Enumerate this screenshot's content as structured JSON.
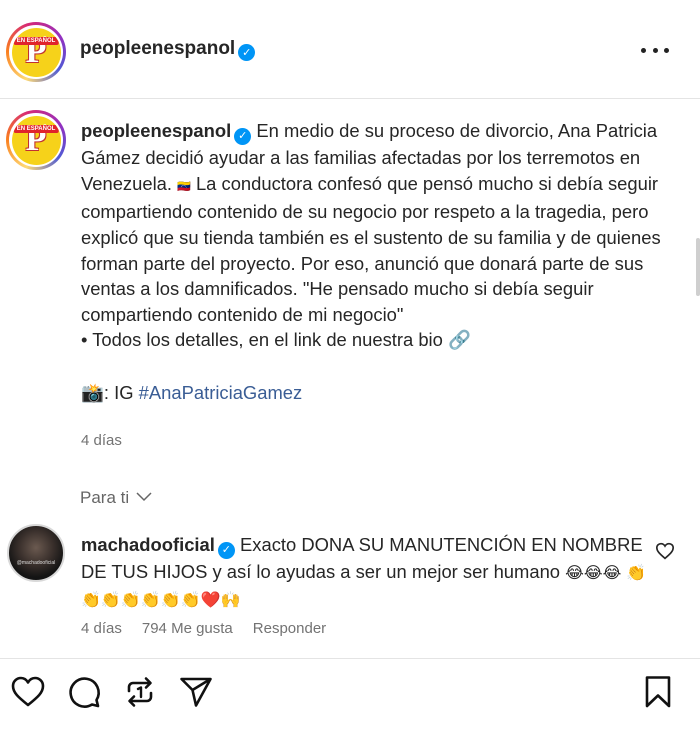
{
  "post": {
    "username": "peopleenespanol",
    "verified": true,
    "avatar_logo": "P",
    "avatar_badge": "EN ESPAÑOL"
  },
  "caption": {
    "username": "peopleenespanol",
    "text_lines": [
      "En medio de su proceso de divorcio, Ana Patricia Gámez decidió ayudar a las familias afectadas por los terremotos en Venezuela. ",
      "🇻🇪",
      " La conductora confesó que pensó mucho si debía seguir compartiendo contenido de su negocio por respeto a la tragedia, pero explicó que su tienda también es el sustento de su familia y de quienes forman parte del proyecto. Por eso, anunció que donará parte de sus ventas a los damnificados. \"He pensado mucho si debía seguir compartiendo contenido de mi negocio\""
    ],
    "bullet": "• Todos los detalles, en el link de nuestra bio",
    "link_emoji": "🔗",
    "credit_prefix": "📸: IG ",
    "hashtag": "#AnaPatriciaGamez"
  },
  "time_ago": "4 días",
  "for_you": "Para ti",
  "comment": {
    "username": "machadooficial",
    "verified": true,
    "text": "Exacto DONA SU MANUTENCIÓN EN NOMBRE DE TUS HIJOS y así lo ayudas a ser un mejor ser humano",
    "emojis": "😂😂😂 👏👏👏👏👏👏👏❤️🙌",
    "avatar_tag": "@machadooficial",
    "time": "4 días",
    "likes": "794 Me gusta",
    "reply": "Responder"
  },
  "icons": {
    "more": "more-icon",
    "like": "heart-icon",
    "comment": "comment-icon",
    "repost": "repost-icon",
    "share": "share-icon",
    "save": "bookmark-icon"
  },
  "colors": {
    "verified": "#0095f6",
    "hashtag": "#3a5d95",
    "muted": "#737373"
  }
}
